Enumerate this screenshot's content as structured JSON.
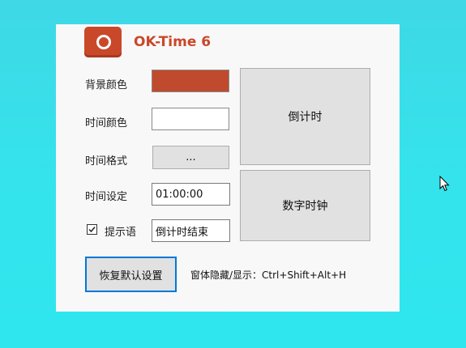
{
  "app": {
    "title": "OK-Time 6"
  },
  "settings": {
    "bg_color_label": "背景颜色",
    "bg_color_value": "#c04a2d",
    "time_color_label": "时间颜色",
    "time_color_value": "#ffffff",
    "time_format_label": "时间格式",
    "time_format_button": "...",
    "time_set_label": "时间设定",
    "time_set_value": "01:00:00",
    "tip_label": "提示语",
    "tip_checked": true,
    "tip_value": "倒计时结束"
  },
  "modes": {
    "countdown_button": "倒计时",
    "clock_button": "数字时钟"
  },
  "footer": {
    "reset_button": "恢复默认设置",
    "shortcut_text": "窗体隐藏/显示：Ctrl+Shift+Alt+H"
  },
  "colors": {
    "brand": "#c9482a"
  }
}
